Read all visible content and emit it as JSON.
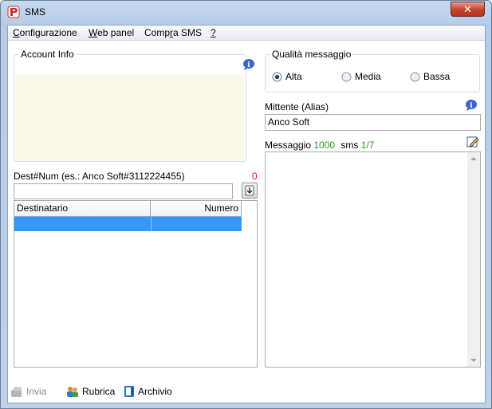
{
  "window": {
    "title": "SMS",
    "close_glyph": "✕",
    "icon": "app-logo-icon"
  },
  "menu": [
    {
      "underline": "C",
      "rest": "onfigurazione"
    },
    {
      "underline": "W",
      "rest": "eb panel"
    },
    {
      "pre": "Comp",
      "underline": "r",
      "rest": "a SMS"
    },
    {
      "underline": "?",
      "rest": ""
    }
  ],
  "account": {
    "label": "Account Info"
  },
  "quality": {
    "label": "Qualità messaggio",
    "options": [
      "Alta",
      "Media",
      "Bassa"
    ],
    "selected": "Alta"
  },
  "sender": {
    "label": "Mittente (Alias)",
    "value": "Anco Soft"
  },
  "message": {
    "label": "Messaggio",
    "chars_left": "1000",
    "sms_label": "sms",
    "sms_count": "1/7",
    "value": ""
  },
  "dest": {
    "label": "Dest#Num (es.: Anco Soft#3112224455)",
    "count": "0",
    "value": ""
  },
  "recipients": {
    "columns": [
      "Destinatario",
      "Numero"
    ],
    "rows": [
      {
        "name": "",
        "number": ""
      }
    ]
  },
  "toolbar": {
    "send": "Invia",
    "rubrica": "Rubrica",
    "archivio": "Archivio"
  },
  "colors": {
    "accent_green": "#2a9a1e",
    "error_red": "#e0201c",
    "selection": "#3399ff"
  }
}
